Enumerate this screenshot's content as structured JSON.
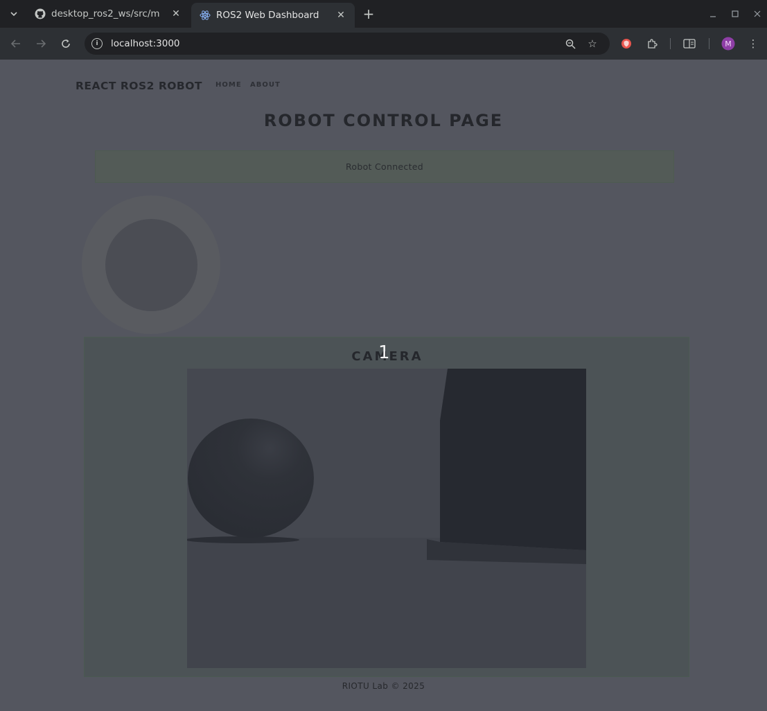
{
  "browser": {
    "tabs": [
      {
        "title": "desktop_ros2_ws/src/m",
        "favicon": "github-icon",
        "active": false
      },
      {
        "title": "ROS2 Web Dashboard",
        "favicon": "react-icon",
        "active": true
      }
    ],
    "url": "localhost:3000"
  },
  "navbar": {
    "brand": "REACT ROS2 ROBOT",
    "links": {
      "home": "HOME",
      "about": "ABOUT"
    }
  },
  "page": {
    "title": "ROBOT CONTROL PAGE",
    "status": "Robot Connected"
  },
  "camera": {
    "title": "CAMERA",
    "overlay_marker": "1"
  },
  "footer": {
    "text": "RIOTU Lab © 2025"
  },
  "colors": {
    "status_background": "#535b57",
    "camera_panel_background": "#4c5356",
    "page_background": "#54565f"
  }
}
